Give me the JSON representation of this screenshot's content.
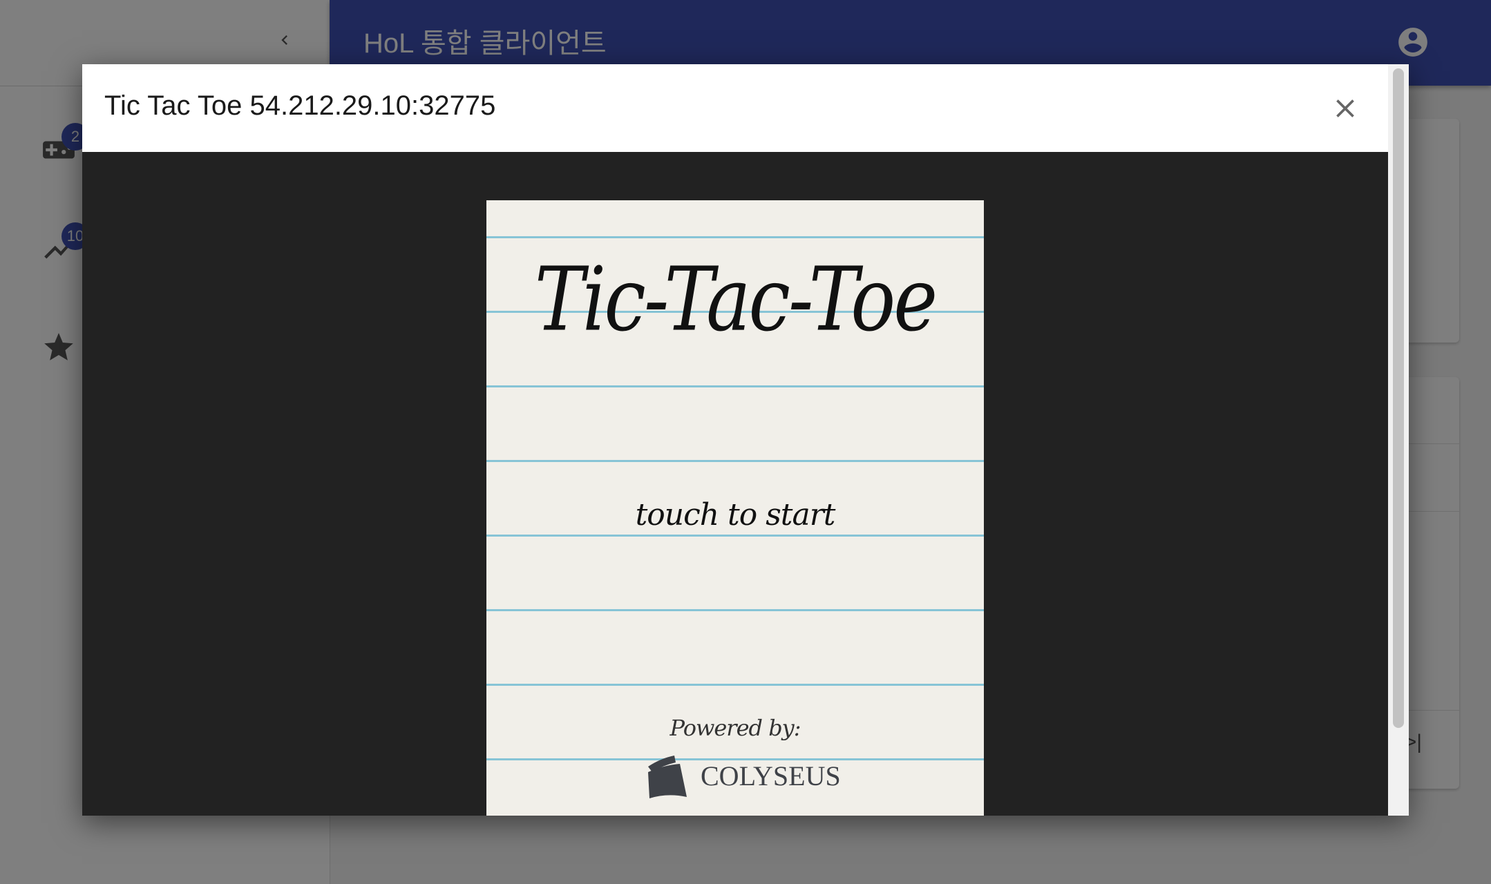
{
  "appbar": {
    "title": "HoL 통합 클라이언트"
  },
  "sidebar": {
    "items": [
      {
        "icon": "gamepad-icon",
        "badge": "2"
      },
      {
        "icon": "trending-icon",
        "badge": "10"
      },
      {
        "icon": "star-icon",
        "badge": ""
      }
    ]
  },
  "dialog": {
    "title": "Tic Tac Toe 54.212.29.10:32775"
  },
  "game": {
    "title": "Tic-Tac-Toe",
    "start": "touch to start",
    "powered_by": "Powered by:",
    "brand": "COLYSEUS"
  },
  "colors": {
    "primary": "#3f51b5",
    "dialog_body": "#222222",
    "paper": "#f1efe9",
    "ruled_line": "#87c4d6"
  }
}
